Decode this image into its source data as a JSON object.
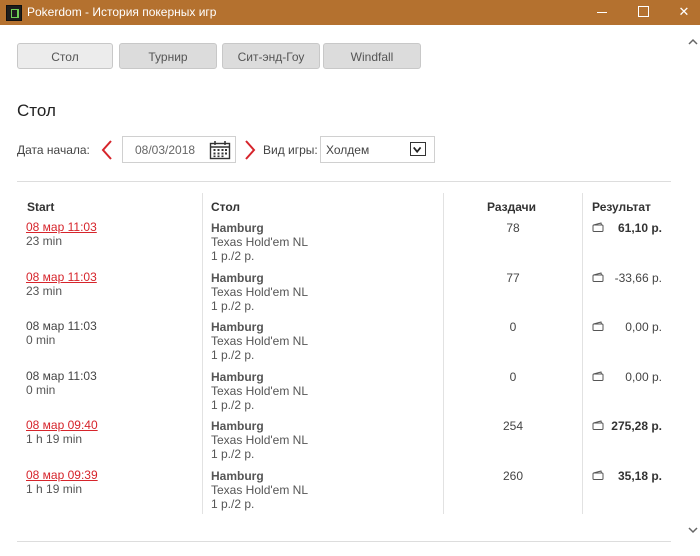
{
  "window": {
    "title": "Pokerdom - История покерных игр"
  },
  "tabs": [
    {
      "label": "Стол",
      "active": true
    },
    {
      "label": "Турнир",
      "active": false
    },
    {
      "label": "Сит-энд-Гоу",
      "active": false
    },
    {
      "label": "Windfall",
      "active": false
    }
  ],
  "heading": "Стол",
  "filters": {
    "start_date_label": "Дата начала:",
    "start_date_value": "08/03/2018",
    "game_type_label": "Вид игры:",
    "game_type_value": "Холдем"
  },
  "columns": {
    "start": "Start",
    "table": "Стол",
    "hands": "Раздачи",
    "result": "Результат"
  },
  "rows": [
    {
      "date": "08 мар 11:03",
      "duration": "23 min",
      "table_name": "Hamburg",
      "game": "Texas Hold'em NL",
      "stakes": "1 р./2 р.",
      "hands": "78",
      "result": "61,10 р.",
      "linked": true,
      "bold": true
    },
    {
      "date": "08 мар 11:03",
      "duration": "23 min",
      "table_name": "Hamburg",
      "game": "Texas Hold'em NL",
      "stakes": "1 р./2 р.",
      "hands": "77",
      "result": "-33,66 р.",
      "linked": true,
      "bold": false
    },
    {
      "date": "08 мар 11:03",
      "duration": "0 min",
      "table_name": "Hamburg",
      "game": "Texas Hold'em NL",
      "stakes": "1 р./2 р.",
      "hands": "0",
      "result": "0,00 р.",
      "linked": false,
      "bold": false
    },
    {
      "date": "08 мар 11:03",
      "duration": "0 min",
      "table_name": "Hamburg",
      "game": "Texas Hold'em NL",
      "stakes": "1 р./2 р.",
      "hands": "0",
      "result": "0,00 р.",
      "linked": false,
      "bold": false
    },
    {
      "date": "08 мар 09:40",
      "duration": "1 h 19 min",
      "table_name": "Hamburg",
      "game": "Texas Hold'em NL",
      "stakes": "1 р./2 р.",
      "hands": "254",
      "result": "275,28 р.",
      "linked": true,
      "bold": true
    },
    {
      "date": "08 мар 09:39",
      "duration": "1 h 19 min",
      "table_name": "Hamburg",
      "game": "Texas Hold'em NL",
      "stakes": "1 р./2 р.",
      "hands": "260",
      "result": "35,18 р.",
      "linked": true,
      "bold": true
    }
  ],
  "colors": {
    "titlebar": "#b4712f",
    "link": "#d6242b",
    "arrow": "#d6242b"
  }
}
